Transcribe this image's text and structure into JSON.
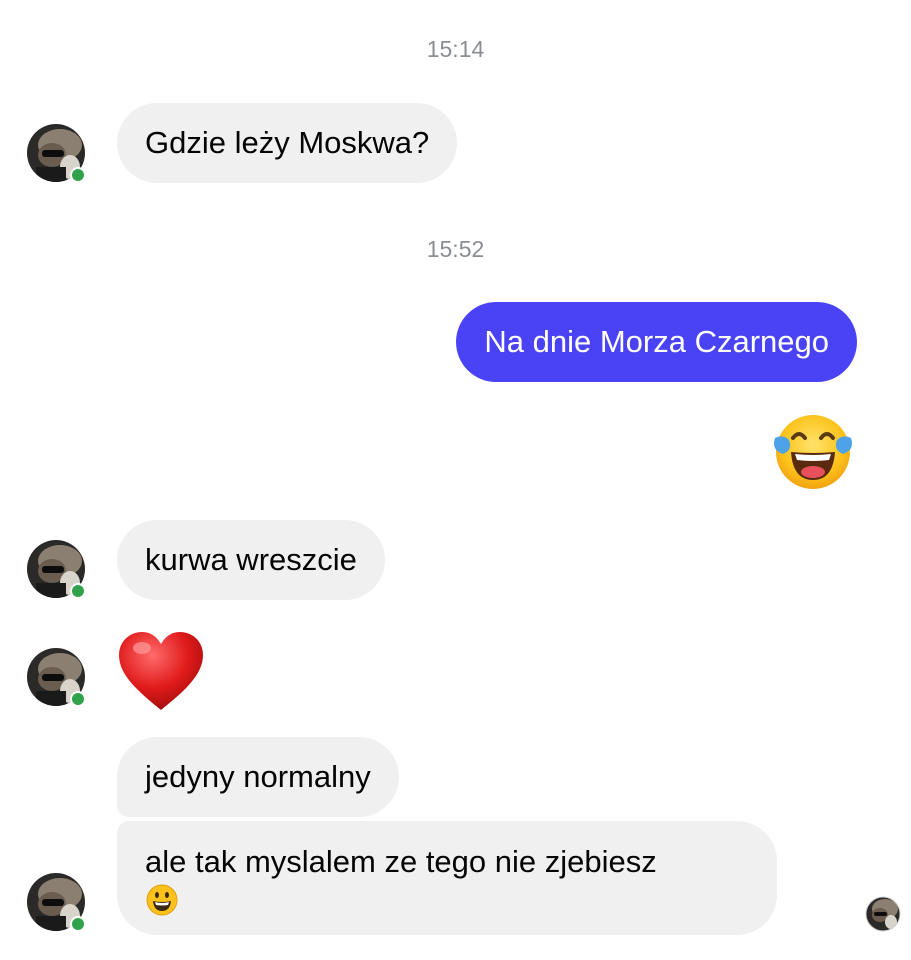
{
  "conversation": {
    "timestamps": [
      "15:14",
      "15:52"
    ],
    "messages": [
      {
        "sender": "them",
        "text": "Gdzie leży Moskwa?"
      },
      {
        "sender": "me",
        "text": "Na dnie Morza Czarnego"
      },
      {
        "sender": "me",
        "emoji": "face-with-tears-of-joy-icon"
      },
      {
        "sender": "them",
        "text": "kurwa wreszcie"
      },
      {
        "sender": "them",
        "emoji": "red-heart-icon"
      },
      {
        "sender": "them",
        "text": "jedyny normalny"
      },
      {
        "sender": "them",
        "text": "ale tak myslalem ze tego nie zjebiesz",
        "trailing_emoji": "grinning-face-icon"
      }
    ]
  },
  "colors": {
    "outgoing_bubble": "#4a43f5",
    "incoming_bubble": "#f0f0f0",
    "online_indicator": "#31a24c",
    "timestamp_text": "#8a8d91"
  }
}
